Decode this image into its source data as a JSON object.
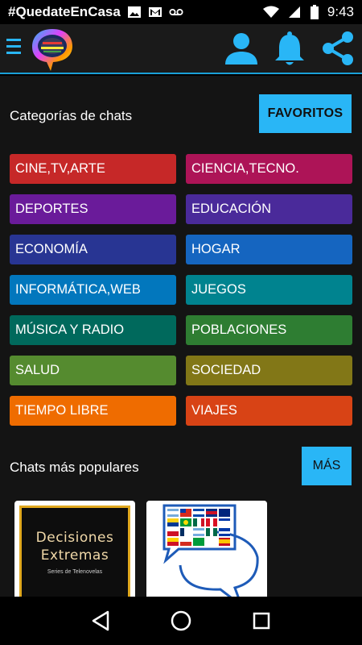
{
  "status_bar": {
    "hashtag": "#QuedateEnCasa",
    "time": "9:43",
    "icons": [
      "image-icon",
      "gmail-icon",
      "voicemail-icon",
      "wifi-icon",
      "signal-icon",
      "battery-icon"
    ]
  },
  "app_bar": {
    "icons": [
      "menu-icon",
      "logo",
      "profile-icon",
      "bell-icon",
      "share-icon"
    ],
    "accent_color": "#29b6f6"
  },
  "categories_section": {
    "title": "Categorías de chats",
    "favorites_label": "FAVORITOS",
    "items": [
      {
        "label": "CINE,TV,ARTE",
        "color": "#c62828"
      },
      {
        "label": "CIENCIA,TECNO.",
        "color": "#ad1457"
      },
      {
        "label": "DEPORTES",
        "color": "#6a1b9a"
      },
      {
        "label": "EDUCACIÓN",
        "color": "#4a2a9a"
      },
      {
        "label": "ECONOMÍA",
        "color": "#283593"
      },
      {
        "label": "HOGAR",
        "color": "#1565c0"
      },
      {
        "label": "INFORMÁTICA,WEB",
        "color": "#0277bd"
      },
      {
        "label": "JUEGOS",
        "color": "#00838f"
      },
      {
        "label": "MÚSICA Y RADIO",
        "color": "#00695c"
      },
      {
        "label": "POBLACIONES",
        "color": "#2e7d32"
      },
      {
        "label": "SALUD",
        "color": "#558b2f"
      },
      {
        "label": "SOCIEDAD",
        "color": "#827717"
      },
      {
        "label": "TIEMPO LIBRE",
        "color": "#ef6c00"
      },
      {
        "label": "VIAJES",
        "color": "#d84315"
      }
    ]
  },
  "popular_section": {
    "title": "Chats más populares",
    "more_label": "MÁS",
    "cards": [
      {
        "title_line1": "Decisiones",
        "title_line2": "Extremas",
        "subtitle": "Series de Telenovelas"
      },
      {
        "image": "latin-flags-chat-bubbles"
      }
    ]
  },
  "nav_bar": {
    "icons": [
      "back-icon",
      "home-icon",
      "recents-icon"
    ]
  }
}
